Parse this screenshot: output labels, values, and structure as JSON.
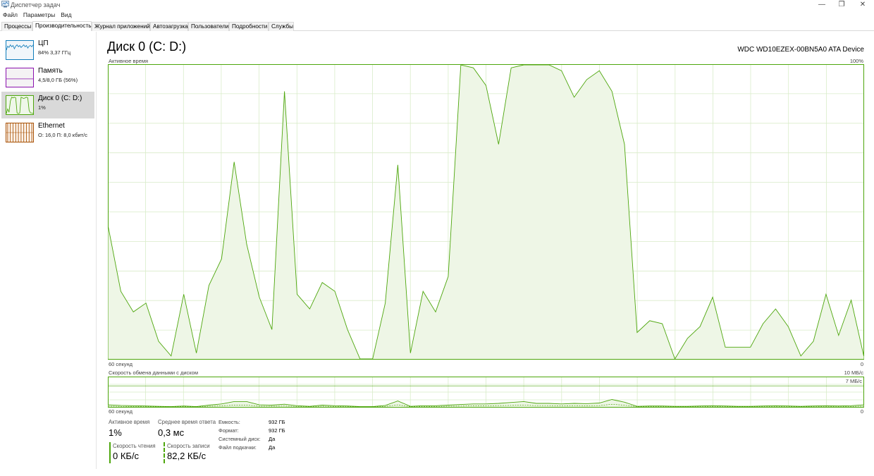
{
  "window": {
    "title": "Диспетчер задач",
    "controls": [
      "—",
      "❐",
      "✕"
    ]
  },
  "menu": [
    "Файл",
    "Параметры",
    "Вид"
  ],
  "tabs": [
    {
      "label": "Процессы",
      "active": false
    },
    {
      "label": "Производительность",
      "active": true
    },
    {
      "label": "Журнал приложений",
      "active": false
    },
    {
      "label": "Автозагрузка",
      "active": false
    },
    {
      "label": "Пользователи",
      "active": false
    },
    {
      "label": "Подробности",
      "active": false
    },
    {
      "label": "Службы",
      "active": false
    }
  ],
  "resources": [
    {
      "name": "ЦП",
      "sub": "84% 3,37 ГГц",
      "color": "#117dbb",
      "fill": "#f1f6fa",
      "selected": false
    },
    {
      "name": "Память",
      "sub": "4,5/8,0 ГБ (56%)",
      "color": "#8b12ae",
      "fill": "#f4f2f4",
      "selected": false
    },
    {
      "name": "Диск 0 (C: D:)",
      "sub": "1%",
      "color": "#4da60c",
      "fill": "#eff7e9",
      "selected": true
    },
    {
      "name": "Ethernet",
      "sub": "О: 16,0 П: 8,0 кбит/с",
      "color": "#a74f01",
      "fill": "#fcf3eb",
      "selected": false
    }
  ],
  "main": {
    "title": "Диск 0 (C: D:)",
    "device": "WDC WD10EZEX-00BN5A0 ATA Device",
    "active_chart": {
      "label": "Активное время",
      "max_label": "100%",
      "xlabel": "60 секунд",
      "min_label": "0"
    },
    "transfer_chart": {
      "label": "Скорость обмена данными с диском",
      "max_label": "10 МБ/с",
      "sub_label": "7 МБ/с",
      "xlabel": "60 секунд",
      "min_label": "0"
    },
    "stats": {
      "active_time_label": "Активное время",
      "active_time_value": "1%",
      "response_label": "Среднее время ответа",
      "response_value": "0,3 мс",
      "read_label": "Скорость чтения",
      "read_value": "0 КБ/с",
      "write_label": "Скорость записи",
      "write_value": "82,2 КБ/с"
    },
    "properties": [
      {
        "key": "Емкость:",
        "value": "932 ГБ"
      },
      {
        "key": "Формат:",
        "value": "932 ГБ"
      },
      {
        "key": "Системный диск:",
        "value": "Да"
      },
      {
        "key": "Файл подкачки:",
        "value": "Да"
      }
    ]
  },
  "chart_data": [
    {
      "type": "area",
      "title": "Активное время",
      "ylabel": "Активное время",
      "xlabel": "60 секунд",
      "ylim": [
        0,
        100
      ],
      "color": "#4da60c",
      "x": [
        0,
        1,
        2,
        3,
        4,
        5,
        6,
        7,
        8,
        9,
        10,
        11,
        12,
        13,
        14,
        15,
        16,
        17,
        18,
        19,
        20,
        21,
        22,
        23,
        24,
        25,
        26,
        27,
        28,
        29,
        30,
        31,
        32,
        33,
        34,
        35,
        36,
        37,
        38,
        39,
        40,
        41,
        42,
        43,
        44,
        45,
        46,
        47,
        48,
        49,
        50,
        51,
        52,
        53,
        54,
        55,
        56,
        57,
        58,
        59,
        60
      ],
      "values": [
        45,
        23,
        16,
        19,
        6,
        1,
        22,
        2,
        25,
        34,
        67,
        39,
        21,
        10,
        91,
        22,
        17,
        26,
        23,
        10,
        0,
        0,
        19,
        66,
        2,
        23,
        16,
        28,
        100,
        99,
        93,
        73,
        99,
        100,
        100,
        100,
        98,
        89,
        95,
        98,
        91,
        73,
        9,
        13,
        12,
        0,
        7,
        11,
        21,
        4,
        4,
        4,
        12,
        17,
        11,
        1,
        6,
        22,
        8,
        20,
        1
      ]
    },
    {
      "type": "area",
      "title": "Скорость обмена данными с диском",
      "xlabel": "60 секунд",
      "ylim": [
        0,
        10
      ],
      "unit": "МБ/с",
      "color": "#4da60c",
      "x": [
        0,
        1,
        2,
        3,
        4,
        5,
        6,
        7,
        8,
        9,
        10,
        11,
        12,
        13,
        14,
        15,
        16,
        17,
        18,
        19,
        20,
        21,
        22,
        23,
        24,
        25,
        26,
        27,
        28,
        29,
        30,
        31,
        32,
        33,
        34,
        35,
        36,
        37,
        38,
        39,
        40,
        41,
        42,
        43,
        44,
        45,
        46,
        47,
        48,
        49,
        50,
        51,
        52,
        53,
        54,
        55,
        56,
        57,
        58,
        59,
        60
      ],
      "values": [
        0.7,
        0.5,
        0.4,
        0.3,
        0.2,
        0.1,
        0.3,
        0.1,
        0.6,
        1.0,
        1.8,
        1.8,
        0.7,
        0.6,
        0.9,
        0.4,
        0.2,
        0.6,
        0.4,
        0.3,
        0.1,
        0.1,
        0.5,
        2.0,
        0.2,
        0.4,
        0.4,
        0.6,
        0.8,
        1.0,
        1.0,
        1.2,
        1.5,
        1.8,
        1.2,
        1.2,
        1.0,
        1.2,
        1.1,
        1.3,
        2.5,
        1.6,
        0.2,
        0.3,
        0.3,
        0.2,
        0.2,
        0.3,
        0.4,
        0.3,
        0.2,
        0.2,
        0.3,
        0.4,
        0.3,
        0.2,
        0.3,
        0.4,
        0.3,
        0.4,
        0.7
      ]
    }
  ]
}
